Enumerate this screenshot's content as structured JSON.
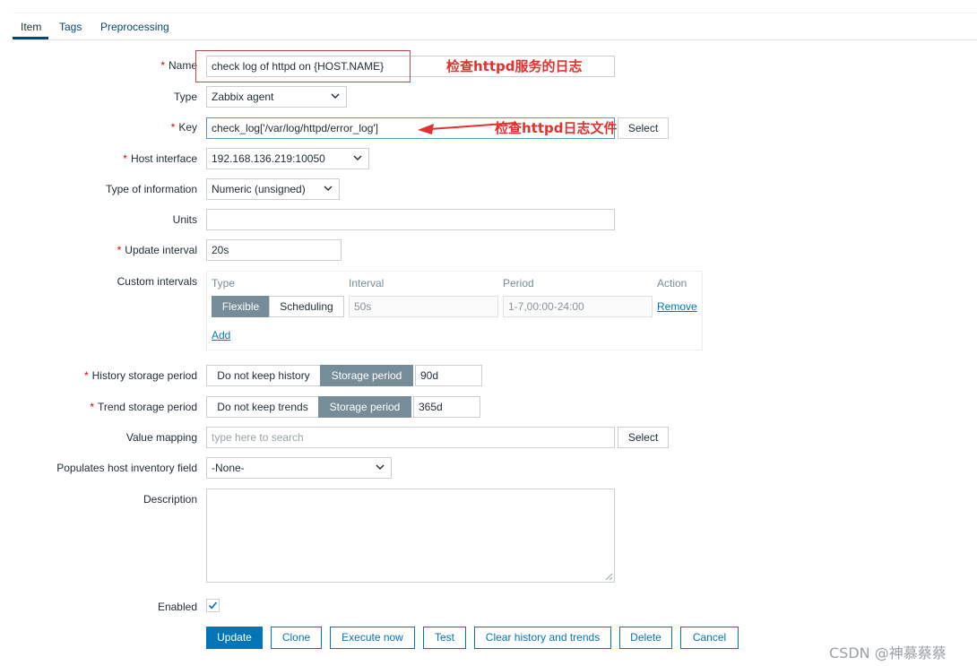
{
  "tabs": [
    {
      "label": "Item"
    },
    {
      "label": "Tags"
    },
    {
      "label": "Preprocessing"
    }
  ],
  "form": {
    "name": {
      "label": "Name",
      "value": "check log of httpd on {HOST.NAME}"
    },
    "type": {
      "label": "Type",
      "value": "Zabbix agent"
    },
    "key": {
      "label": "Key",
      "value": "check_log['/var/log/httpd/error_log']",
      "button": "Select"
    },
    "host_interface": {
      "label": "Host interface",
      "value": "192.168.136.219:10050"
    },
    "type_of_information": {
      "label": "Type of information",
      "value": "Numeric (unsigned)"
    },
    "units": {
      "label": "Units",
      "value": ""
    },
    "update_interval": {
      "label": "Update interval",
      "value": "20s"
    },
    "custom_intervals": {
      "label": "Custom intervals",
      "columns": [
        "Type",
        "Interval",
        "Period",
        "Action"
      ],
      "row": {
        "flexible": "Flexible",
        "scheduling": "Scheduling",
        "interval": "50s",
        "period": "1-7,00:00-24:00",
        "remove": "Remove"
      },
      "add": "Add"
    },
    "history": {
      "label": "History storage period",
      "off": "Do not keep history",
      "on": "Storage period",
      "value": "90d"
    },
    "trend": {
      "label": "Trend storage period",
      "off": "Do not keep trends",
      "on": "Storage period",
      "value": "365d"
    },
    "value_mapping": {
      "label": "Value mapping",
      "placeholder": "type here to search",
      "button": "Select"
    },
    "inventory": {
      "label": "Populates host inventory field",
      "value": "-None-"
    },
    "description": {
      "label": "Description",
      "value": ""
    },
    "enabled": {
      "label": "Enabled",
      "checked": true
    }
  },
  "footer": {
    "update": "Update",
    "clone": "Clone",
    "execute": "Execute now",
    "test": "Test",
    "clear": "Clear history and trends",
    "delete": "Delete",
    "cancel": "Cancel"
  },
  "annotations": {
    "name_note": "检查httpd服务的日志",
    "key_note": "检查httpd日志文件"
  },
  "watermark": "CSDN @神慕蔡蔡",
  "colors": {
    "accent": "#0275b8",
    "segment_active": "#768d99",
    "required": "#d40000",
    "annotation": "#e3312f"
  }
}
